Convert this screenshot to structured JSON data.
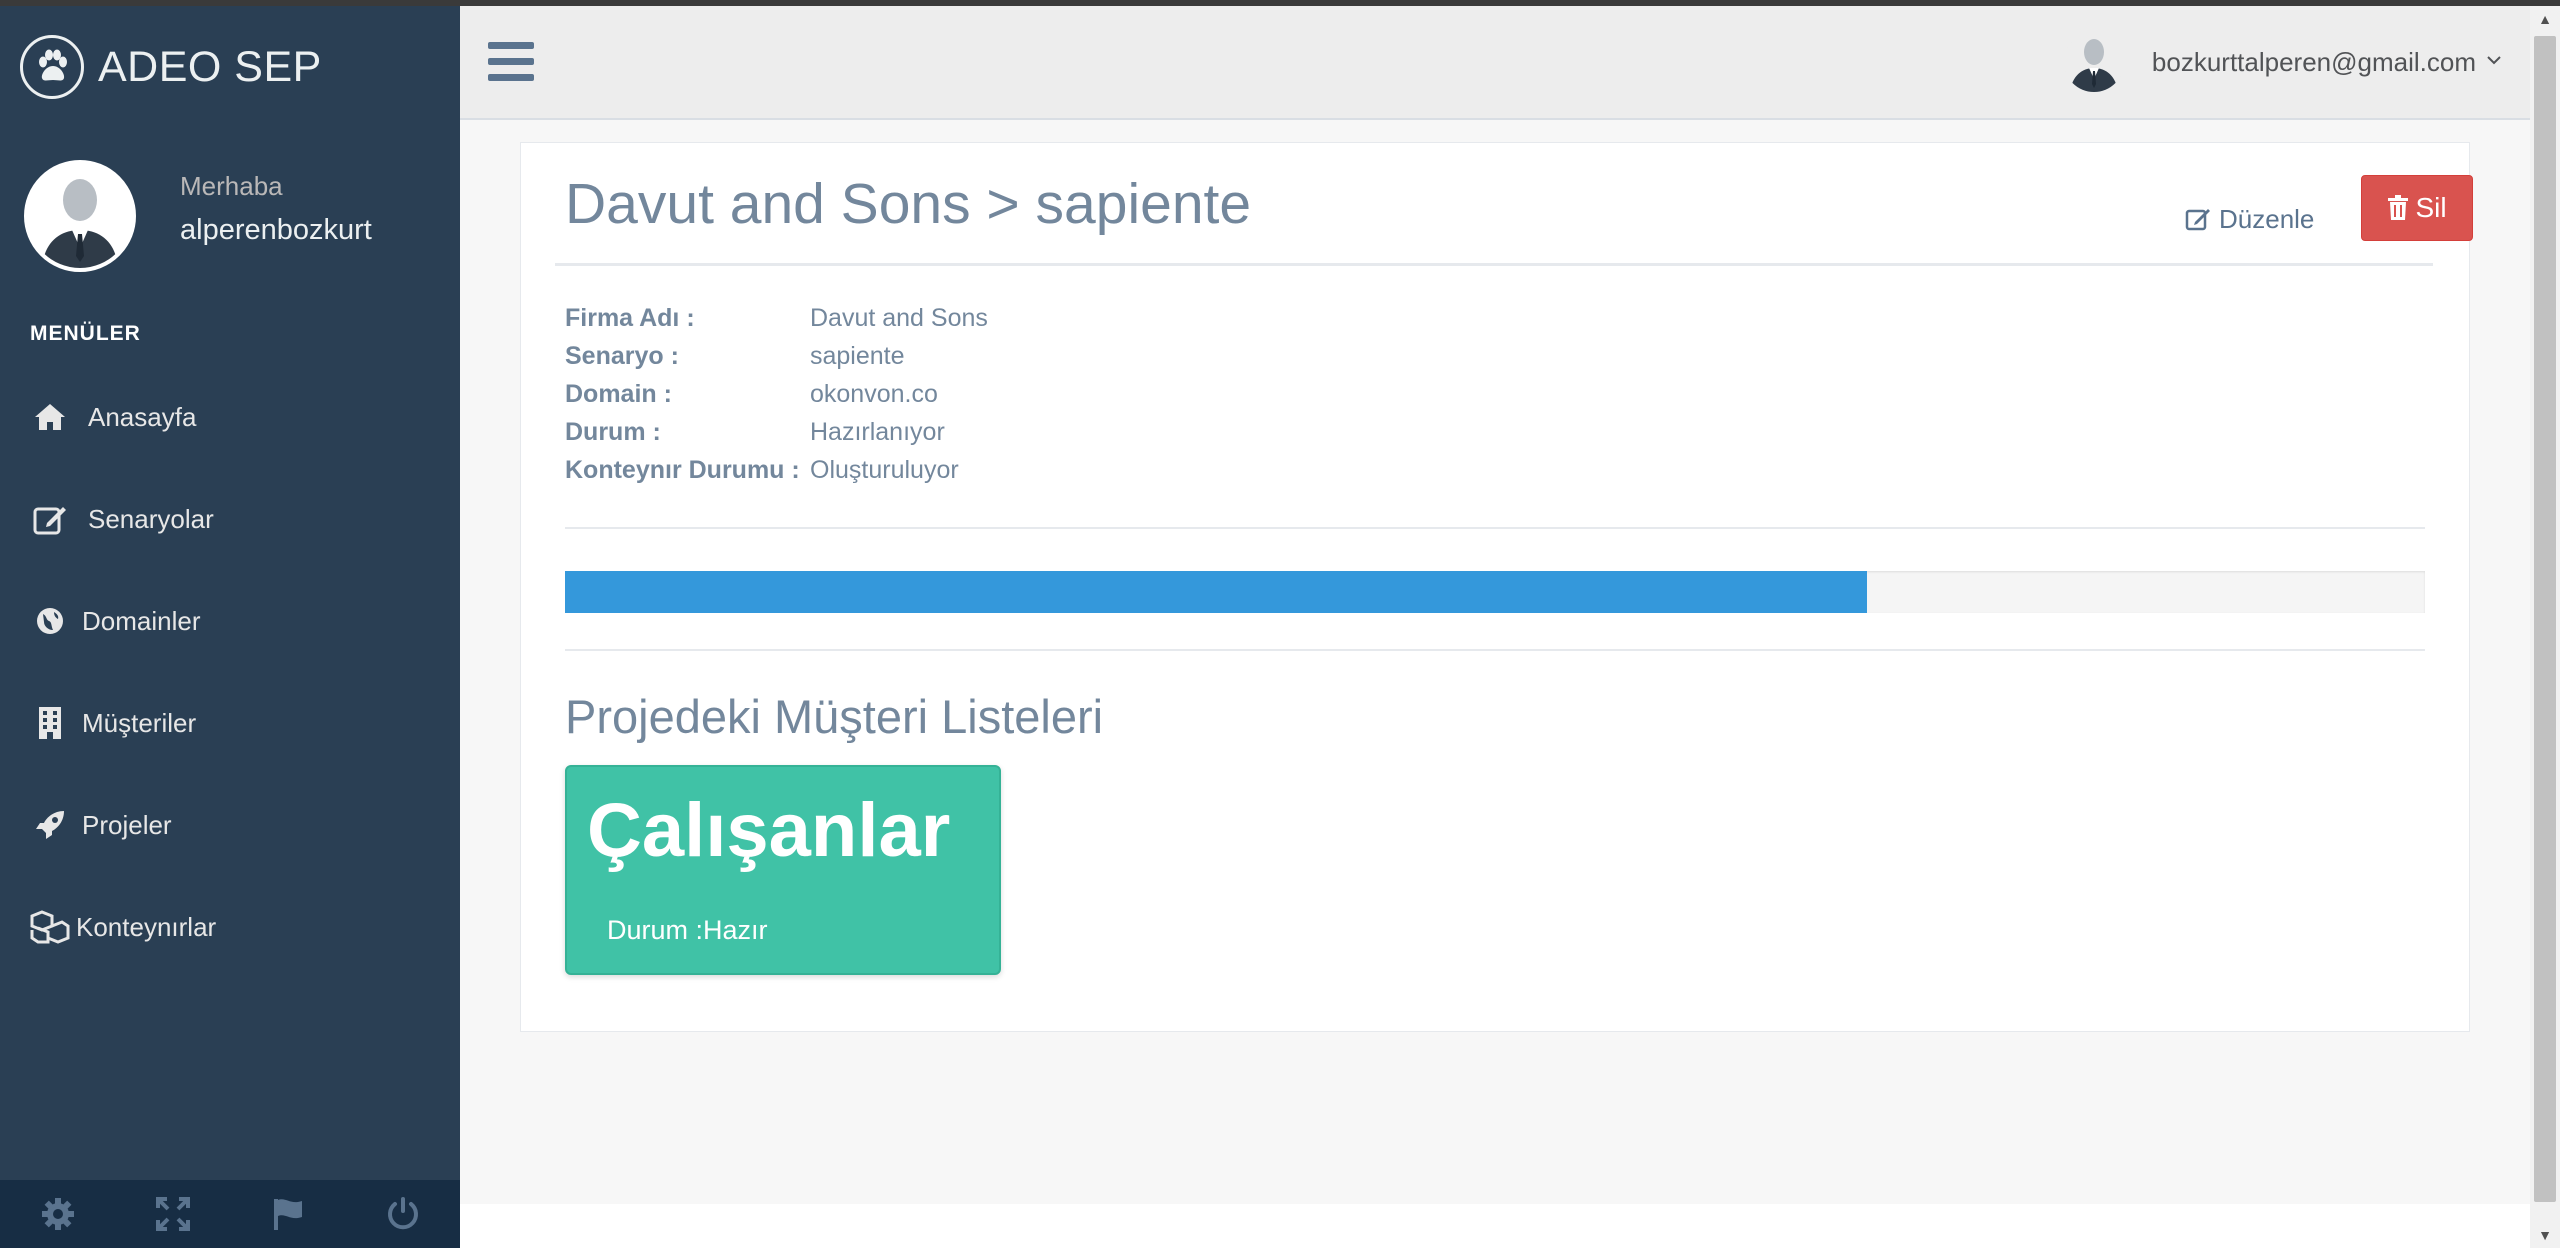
{
  "app": {
    "title": "ADEO SEP"
  },
  "profile": {
    "greeting": "Merhaba",
    "username": "alperenbozkurt"
  },
  "sidebar": {
    "section_title": "MENÜLER",
    "items": [
      {
        "label": "Anasayfa",
        "icon": "home-icon"
      },
      {
        "label": "Senaryolar",
        "icon": "edit-icon"
      },
      {
        "label": "Domainler",
        "icon": "globe-icon"
      },
      {
        "label": "Müşteriler",
        "icon": "building-icon"
      },
      {
        "label": "Projeler",
        "icon": "rocket-icon"
      },
      {
        "label": "Konteynırlar",
        "icon": "cubes-icon"
      }
    ],
    "footer_icons": [
      "gear-icon",
      "fullscreen-icon",
      "flag-icon",
      "power-icon"
    ]
  },
  "header": {
    "user_email": "bozkurttalperen@gmail.com"
  },
  "project": {
    "title": "Davut and Sons > sapiente",
    "edit_label": "Düzenle",
    "delete_label": "Sil",
    "details": [
      {
        "label": "Firma Adı :",
        "value": "Davut and Sons"
      },
      {
        "label": "Senaryo :",
        "value": "sapiente"
      },
      {
        "label": "Domain :",
        "value": "okonvon.co"
      },
      {
        "label": "Durum :",
        "value": "Hazırlanıyor"
      },
      {
        "label": "Konteynır Durumu :",
        "value": "Oluşturuluyor"
      }
    ],
    "progress_percent": 70
  },
  "customer_lists": {
    "section_title": "Projedeki Müşteri Listeleri",
    "cards": [
      {
        "title": "Çalışanlar",
        "status": "Durum :Hazır"
      }
    ]
  },
  "colors": {
    "sidebar_bg": "#2a3f54",
    "progress": "#3498db",
    "card": "#40c2a6",
    "danger": "#d9534f"
  }
}
